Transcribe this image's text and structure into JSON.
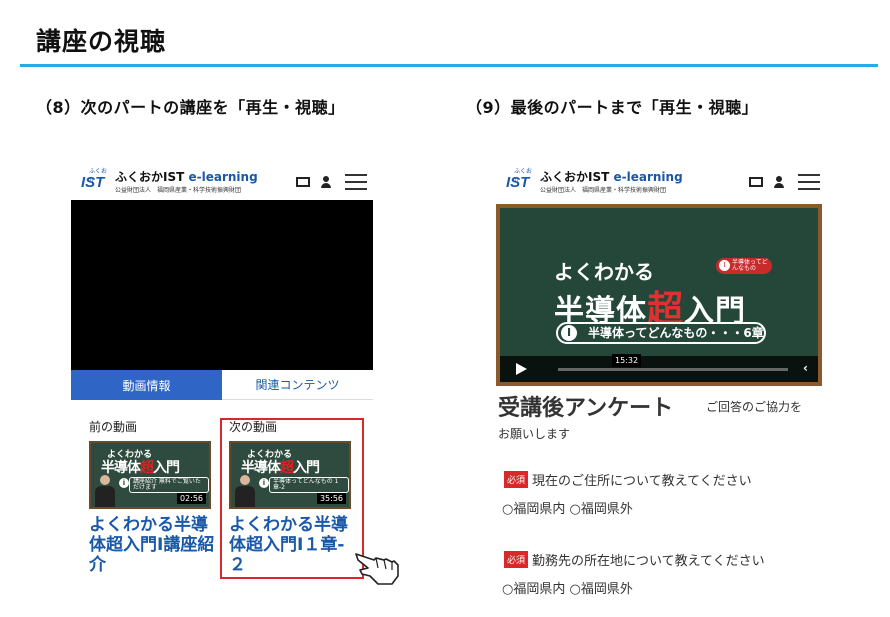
{
  "slide": {
    "title": "講座の視聴",
    "step_left": "（8）次のパートの講座を「再生・視聴」",
    "step_right": "（9）最後のパートまで「再生・視聴」",
    "accent_color": "#29abe2"
  },
  "site": {
    "logo_small": "ふくおか",
    "logo_mark": "IST",
    "logo_name_prefix": "ふくおかIST",
    "logo_name_suffix": "e-learning",
    "logo_sub": "公益財団法人　福岡県産業・科学技術振興財団",
    "icons": [
      "cart-icon",
      "user-icon",
      "menu-icon"
    ]
  },
  "left_screen": {
    "tabs": [
      {
        "label": "動画情報",
        "active": true
      },
      {
        "label": "関連コンテンツ",
        "active": false
      }
    ],
    "prev": {
      "label": "前の動画",
      "thumb_line1": "よくわかる",
      "thumb_line2_a": "半導体",
      "thumb_line2_b": "超",
      "thumb_line2_c": "入門",
      "thumb_box": "講座紹介 無料でご覧いただけます",
      "duration": "02:56",
      "title": "よくわかる半導体超入門Ⅰ講座紹介"
    },
    "next": {
      "label": "次の動画",
      "thumb_line1": "よくわかる",
      "thumb_line2_a": "半導体",
      "thumb_line2_b": "超",
      "thumb_line2_c": "入門",
      "thumb_box": "半導体ってどんなもの 1章-2",
      "duration": "35:56",
      "title": "よくわかる半導体超入門Ⅰ１章-２"
    },
    "highlight_color": "#d62a2a"
  },
  "right_screen": {
    "video": {
      "line1": "よくわかる",
      "line2_a": "半導体",
      "line2_b": "超",
      "line2_c": "入門",
      "badge": "半導体ってどんなもの",
      "badge_num": "Ⅰ",
      "chapter_num": "Ⅰ",
      "chapter": "半導体ってどんなもの・・・6章",
      "timestamp": "15:32"
    },
    "survey": {
      "title": "受講後アンケート",
      "note_a": "ご回答のご協力を",
      "note_b": "お願いします",
      "required_label": "必須",
      "questions": [
        {
          "text": "現在のご住所について教えてください",
          "options": "○福岡県内 ○福岡県外"
        },
        {
          "text": "勤務先の所在地について教えてください",
          "options": "○福岡県内 ○福岡県外"
        }
      ]
    }
  }
}
